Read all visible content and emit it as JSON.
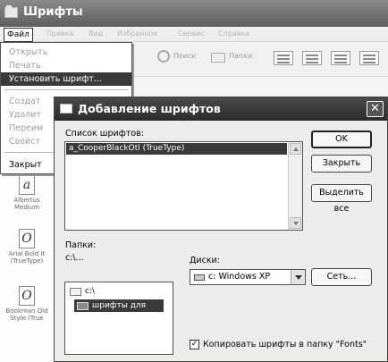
{
  "bg_window": {
    "title": "Шрифты",
    "menu": [
      "Файл",
      "Правка",
      "Вид",
      "Избранное",
      "Сервис",
      "Справка"
    ],
    "toolbar": {
      "search": "Поиск",
      "folders": "Папки"
    },
    "font_files": [
      {
        "glyph": "a",
        "name": "Albertus Medium"
      },
      {
        "glyph": "O",
        "name": "Arial Bold It (TrueType)"
      },
      {
        "glyph": "O",
        "name": "Bookman Old Style (True"
      }
    ]
  },
  "file_menu": {
    "items": [
      "Открыть",
      "Печать",
      "Установить шрифт...",
      "Создат",
      "Удалит",
      "Переим",
      "Свойст",
      "Закрыт"
    ]
  },
  "dialog": {
    "title": "Добавление шрифтов",
    "close_glyph": "✕",
    "fonts_list_label": "Список шрифтов:",
    "fonts_list": [
      "a_CooperBlackOtl (TrueType)"
    ],
    "buttons": {
      "ok": "OK",
      "close": "Закрыть",
      "select_all": "Выделить все",
      "network": "Сеть..."
    },
    "folders_label": "Папки:",
    "current_path": "c:\\...",
    "folders": [
      "c:\\",
      "шрифты для уста"
    ],
    "drives_label": "Диски:",
    "drive_selected": "c: Windows XP",
    "copy_checkbox_label": "Копировать шрифты в папку \"Fonts\"",
    "copy_checked": true,
    "check_glyph": "✓"
  }
}
